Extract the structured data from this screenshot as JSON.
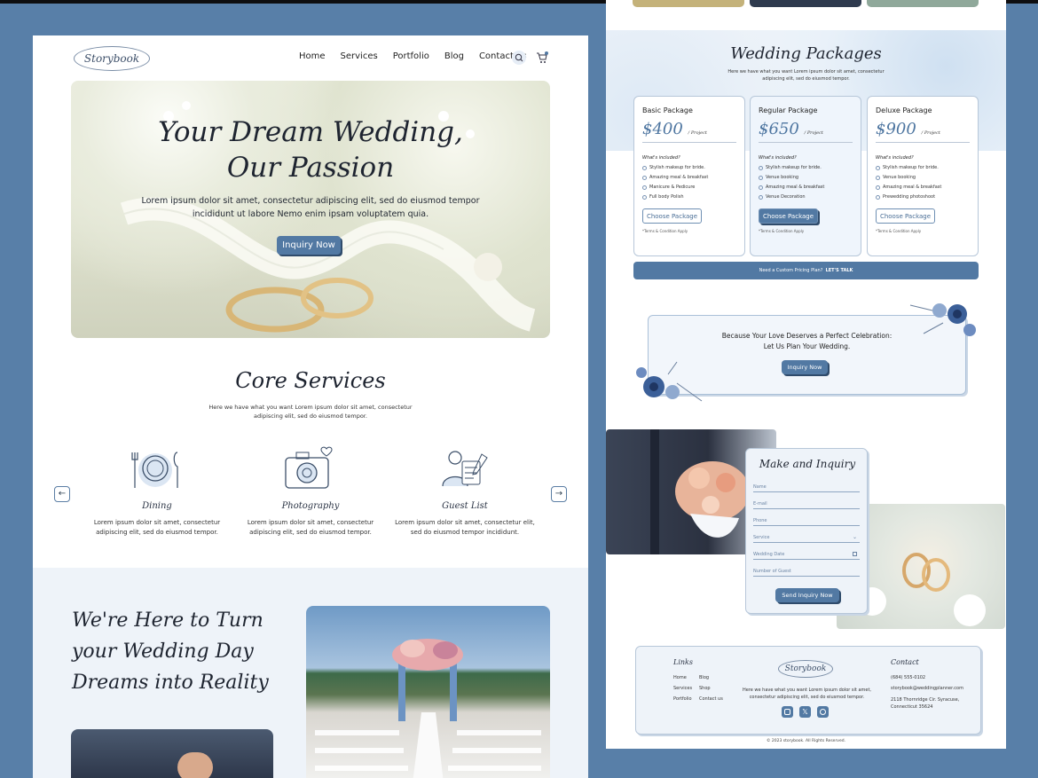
{
  "header": {
    "logo": "Storybook",
    "nav": [
      "Home",
      "Services",
      "Portfolio",
      "Blog",
      "Contact us"
    ]
  },
  "hero": {
    "title_line1": "Your Dream Wedding,",
    "title_line2": "Our Passion",
    "body_line1": "Lorem ipsum dolor sit amet, consectetur adipiscing elit, sed do eiusmod tempor",
    "body_line2": "incididunt ut labore Nemo enim ipsam voluptatem quia.",
    "button": "Inquiry Now"
  },
  "services": {
    "title": "Core Services",
    "sub_line1": "Here we have what you want Lorem ipsum dolor sit amet, consectetur",
    "sub_line2": "adipiscing elit, sed do eiusmod tempor.",
    "items": [
      {
        "title": "Dining",
        "line1": "Lorem ipsum dolor sit amet, consectetur",
        "line2": "adipiscing elit, sed do eiusmod tempor."
      },
      {
        "title": "Photography",
        "line1": "Lorem ipsum dolor sit amet, consectetur",
        "line2": "adipiscing elit, sed do eiusmod tempor."
      },
      {
        "title": "Guest List",
        "line1": "Lorem ipsum dolor sit amet, consectetur elit,",
        "line2": "sed do eiusmod tempor incididunt."
      }
    ],
    "prev": "←",
    "next": "→"
  },
  "about": {
    "line1": "We're Here to Turn",
    "line2": "your Wedding Day",
    "line3": "Dreams into Reality"
  },
  "packages": {
    "title": "Wedding Packages",
    "sub_line1": "Here we have what you want Lorem ipsum dolor sit amet, consectetur",
    "sub_line2": "adipiscing elit, sed do eiusmod tempor.",
    "included_label": "What's included?",
    "per": "/ Project",
    "terms": "*Terms & Condition Apply",
    "button": "Choose Package",
    "items": [
      {
        "name": "Basic Package",
        "price": "$400",
        "features": [
          "Stylish makeup for bride.",
          "Amazing meal & breakfast",
          "Manicure & Pedicure",
          "Full body Polish"
        ]
      },
      {
        "name": "Regular Package",
        "price": "$650",
        "features": [
          "Stylish makeup for bride.",
          "Venue booking",
          "Amazing meal & breakfast",
          "Venue Decoration"
        ]
      },
      {
        "name": "Deluxe Package",
        "price": "$900",
        "features": [
          "Stylish makeup for bride.",
          "Venue booking",
          "Amazing meal & breakfast",
          "Prewedding photoshoot"
        ]
      }
    ],
    "custom_text": "Need a Custom Pricing Plan?",
    "custom_link": "LET'S TALK"
  },
  "cta": {
    "line1": "Because Your Love Deserves a Perfect Celebration:",
    "line2": "Let Us Plan Your Wedding.",
    "button": "Inquiry Now"
  },
  "inquiry": {
    "title": "Make and Inquiry",
    "fields": [
      "Name",
      "E-mail",
      "Phone",
      "Service",
      "Wedding Date",
      "Number of Guest"
    ],
    "button": "Send Inquiry Now"
  },
  "footer": {
    "links_title": "Links",
    "links": [
      "Home",
      "Blog",
      "Services",
      "Shop",
      "Portfolio",
      "Contact us"
    ],
    "logo": "Storybook",
    "desc_line1": "Here we have what you want Lorem ipsum dolor sit amet,",
    "desc_line2": "consectetur adipiscing elit, sed do eiusmod tempor.",
    "contact_title": "Contact",
    "phone": "(684) 555-0102",
    "email": "storybook@weddingplanner.com",
    "addr_line1": "2118 Thornridge Cir. Syracuse,",
    "addr_line2": "Connecticut 35624",
    "copyright": "© 2023 storybook. All Rights Reserved."
  },
  "colors": {
    "bg": "#587fa8",
    "accent": "#5279a3",
    "light": "#eef3f9"
  }
}
